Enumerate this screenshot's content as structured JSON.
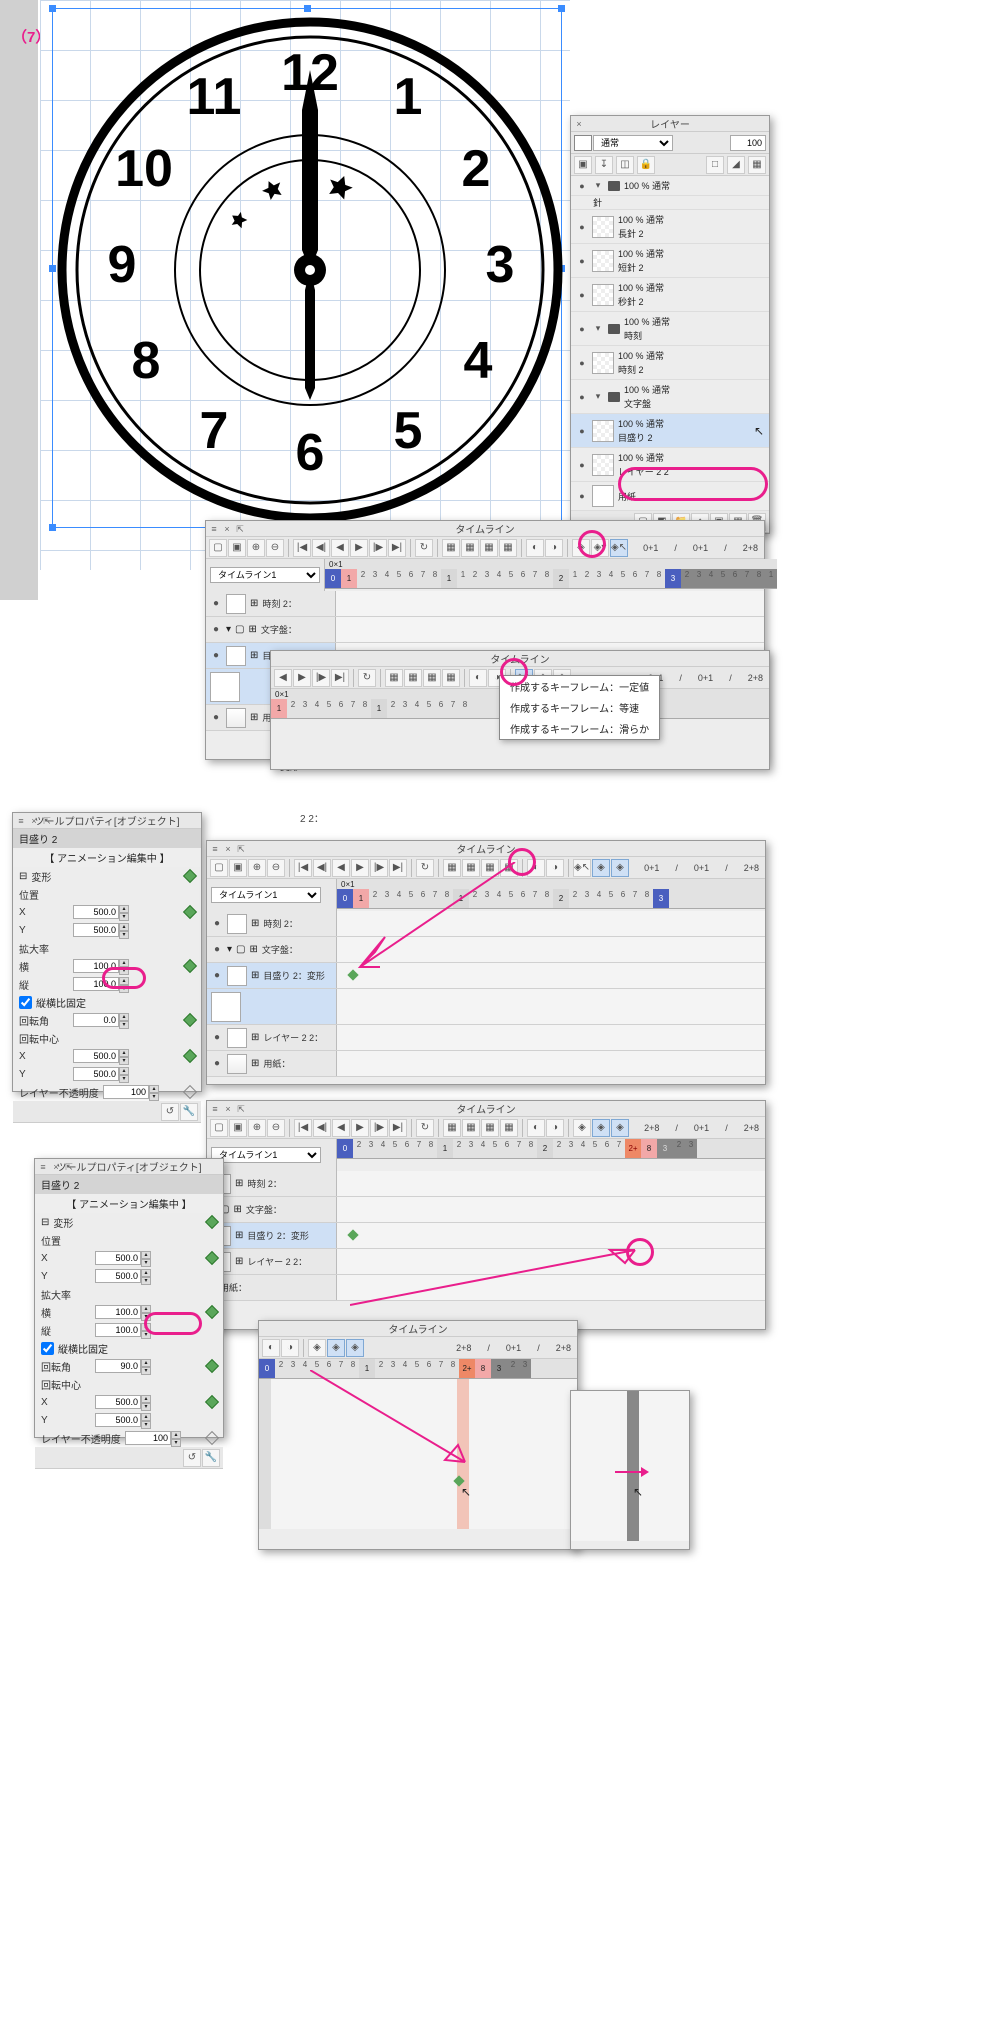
{
  "step_label": "（7）",
  "layer_panel": {
    "title": "レイヤー",
    "blend_mode": "通常",
    "opacity": "100",
    "groups": [
      {
        "opacity": "100 % 通常",
        "name": "針"
      },
      {
        "opacity": "100 % 通常",
        "name": "長針 2"
      },
      {
        "opacity": "100 % 通常",
        "name": "短針 2"
      },
      {
        "opacity": "100 % 通常",
        "name": "秒針 2"
      },
      {
        "opacity": "100 % 通常",
        "name": "時刻",
        "folder": true
      },
      {
        "opacity": "100 % 通常",
        "name": "時刻 2"
      },
      {
        "opacity": "100 % 通常",
        "name": "文字盤",
        "folder": true
      },
      {
        "opacity": "100 % 通常",
        "name": "目盛り 2",
        "sel": true
      },
      {
        "opacity": "100 % 通常",
        "name": "レイヤー 2 2"
      },
      {
        "opacity": "",
        "name": "用紙"
      }
    ]
  },
  "timeline": {
    "title": "タイムライン",
    "selector": "タイムライン1",
    "zoom_label": "0×1",
    "numbers": {
      "zero": "0",
      "one": "1",
      "two": "2",
      "three": "3",
      "four": "4"
    },
    "right_labels": {
      "a": "0+1",
      "b": "0+1",
      "c": "2+8",
      "d": "/",
      "e": "2+8"
    },
    "tracks": [
      {
        "name": "時刻 2：",
        "sel": false
      },
      {
        "name": "文字盤：",
        "sel": false,
        "folder": true
      },
      {
        "name": "目盛り 2：変形",
        "sel": true
      },
      {
        "name": "レイヤー 2 2：",
        "sel": false
      },
      {
        "name": "用紙：",
        "sel": false
      }
    ],
    "keyframe_menu": {
      "constant": "作成するキーフレーム：一定値",
      "linear": "作成するキーフレーム：等速",
      "smooth": "作成するキーフレーム：滑らか"
    }
  },
  "tool_prop": {
    "title": "ツールプロパティ[オブジェクト]",
    "layer_name": "目盛り 2",
    "anim_editing": "【 アニメーション編集中 】",
    "group_transform": "変形",
    "pos_label": "位置",
    "x_label": "X",
    "y_label": "Y",
    "x": "500.0",
    "y": "500.0",
    "scale_label": "拡大率",
    "w_label": "横",
    "h_label": "縦",
    "w": "100.0",
    "h": "100.0",
    "lock_aspect": "縦横比固定",
    "rot_label": "回転角",
    "rot0": "0.0",
    "rot90": "90.0",
    "center_label": "回転中心",
    "cx": "500.0",
    "cy": "500.0",
    "opacity_label": "レイヤー不透明度",
    "opacity": "100"
  },
  "extra": {
    "transform_word": "変形",
    "two_two": "2 2："
  }
}
